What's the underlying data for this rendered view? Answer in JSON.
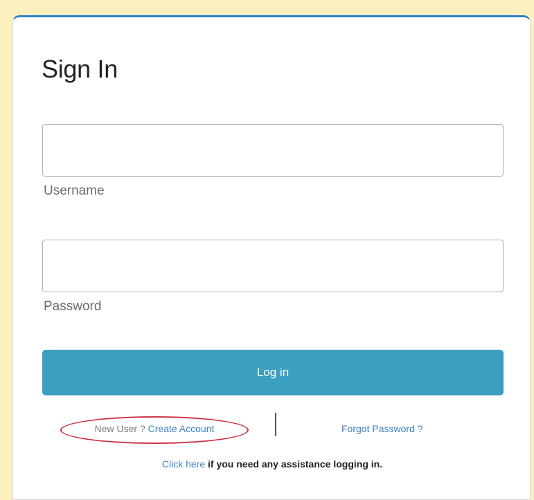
{
  "signin": {
    "title": "Sign In",
    "username_label": "Username",
    "username_value": "",
    "password_label": "Password",
    "password_value": "",
    "login_button": "Log in",
    "new_user_prompt": "New User ?",
    "create_account_link": "Create Account",
    "forgot_password_link": "Forgot Password ?",
    "help_link": "Click here",
    "help_text": " if you need any assistance logging in."
  },
  "colors": {
    "page_background": "#fdf0bf",
    "card_top_border": "#2f7fc6",
    "login_button": "#3a9fc0",
    "link": "#3b7fc4",
    "highlight_ellipse": "#cc3344"
  }
}
